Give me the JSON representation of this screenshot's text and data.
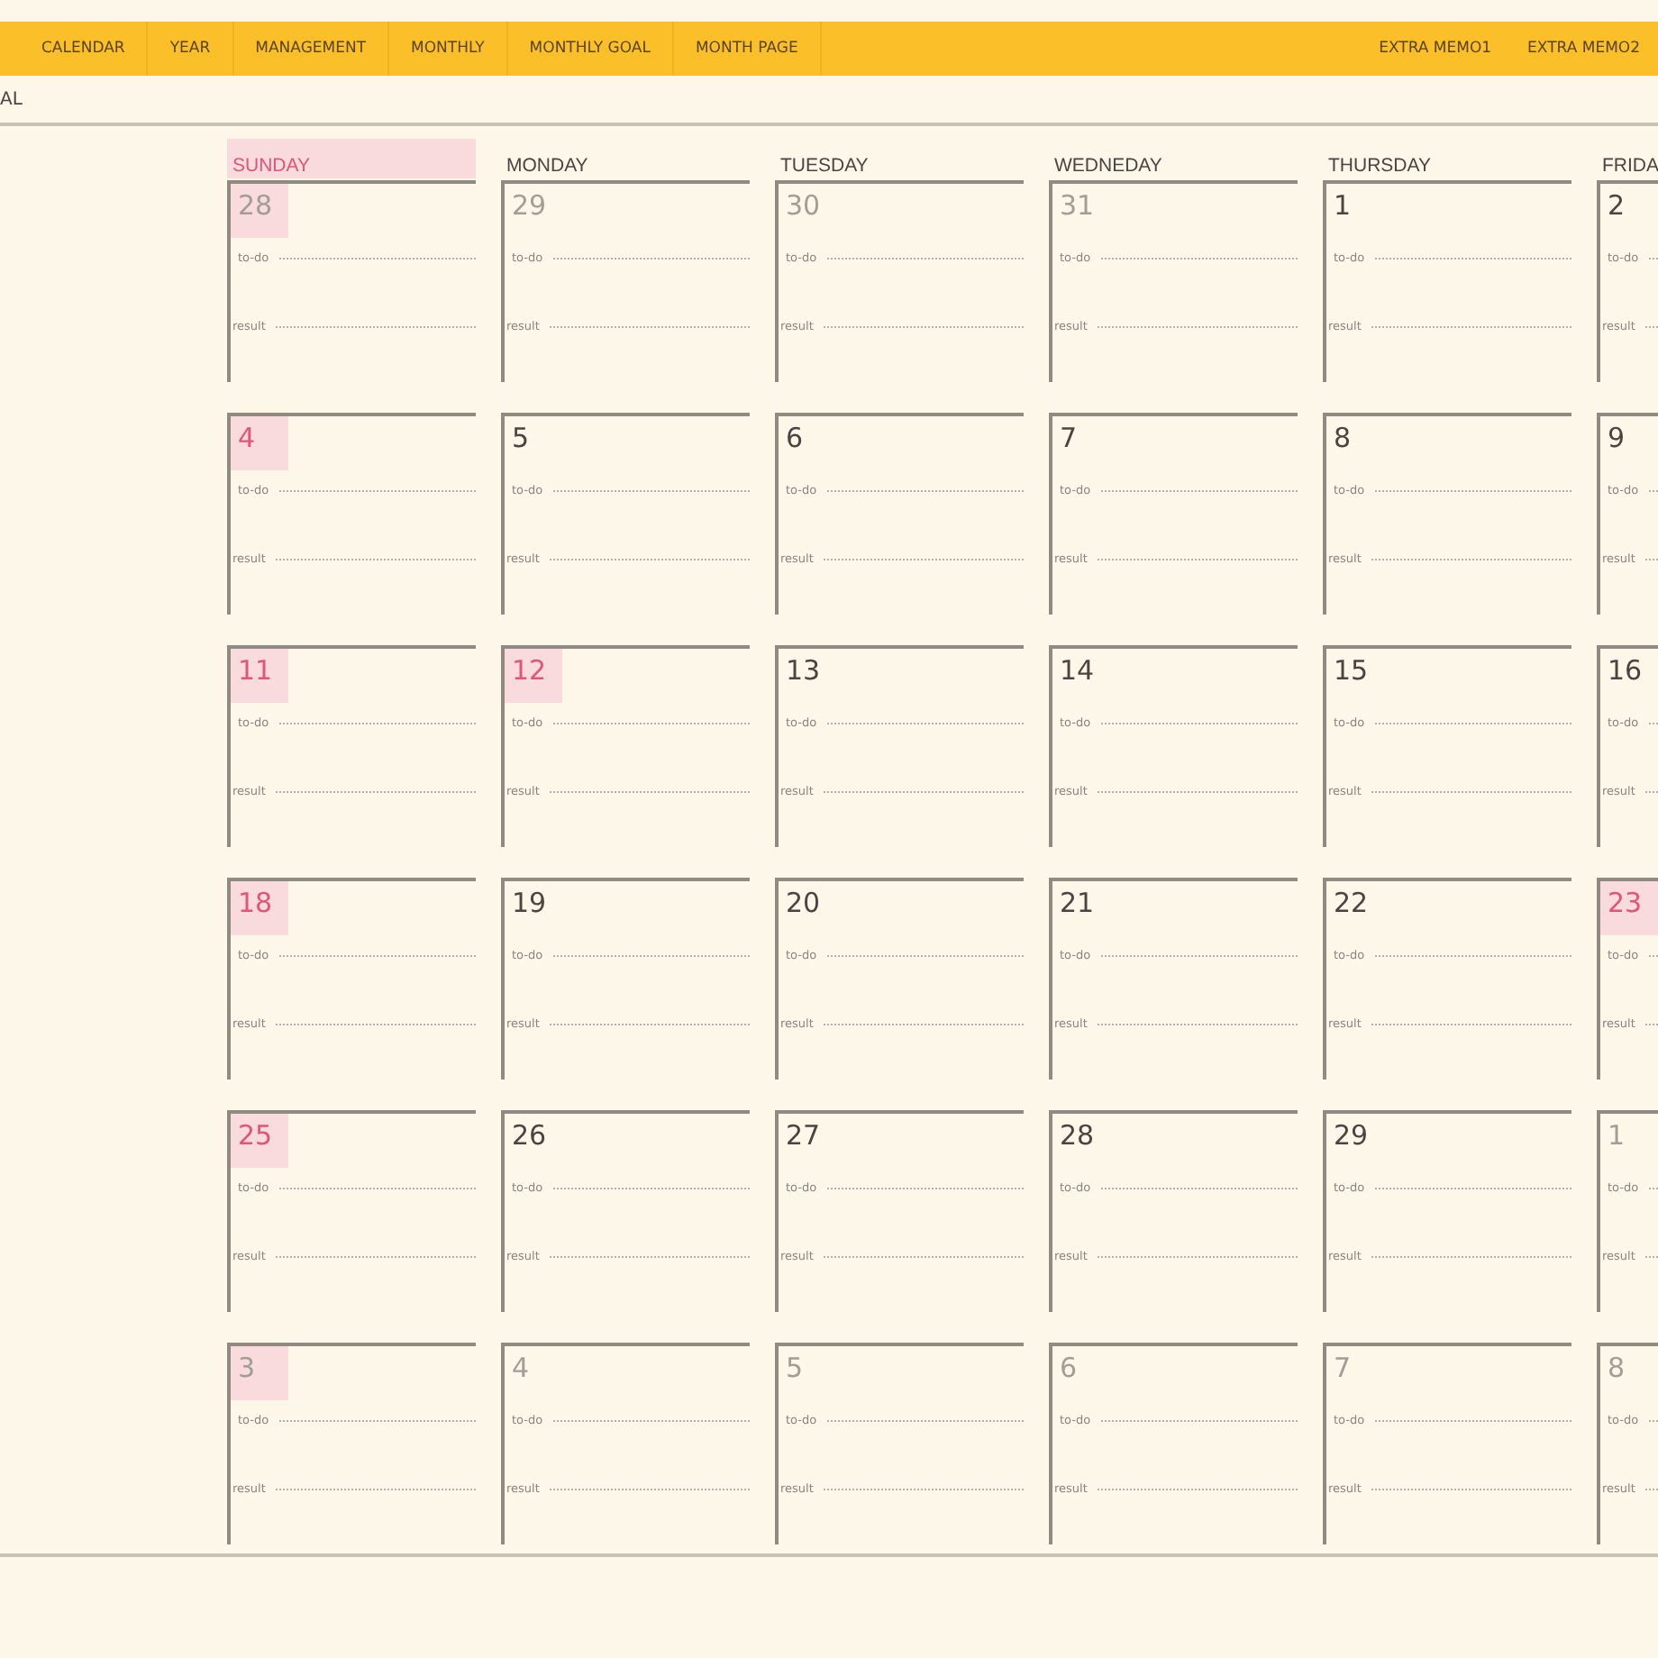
{
  "nav_tabs": [
    {
      "label": "CALENDAR"
    },
    {
      "label": "YEAR"
    },
    {
      "label": "MANAGEMENT"
    },
    {
      "label": "MONTHLY"
    },
    {
      "label": "MONTHLY GOAL"
    },
    {
      "label": "MONTH PAGE"
    }
  ],
  "nav_tabs_right": [
    {
      "label": "EXTRA MEMO1"
    },
    {
      "label": "EXTRA MEMO2"
    }
  ],
  "section_title": "AL",
  "weekdays": [
    {
      "label": "SUNDAY",
      "holiday": true
    },
    {
      "label": "MONDAY",
      "holiday": false
    },
    {
      "label": "TUESDAY",
      "holiday": false
    },
    {
      "label": "WEDNEDAY",
      "holiday": false
    },
    {
      "label": "THURSDAY",
      "holiday": false
    },
    {
      "label": "FRIDA",
      "holiday": false
    }
  ],
  "weeks": [
    [
      {
        "number": "28",
        "holiday": true,
        "other_month": true,
        "todo": "to-do",
        "result": "result"
      },
      {
        "number": "29",
        "holiday": false,
        "other_month": true,
        "todo": "to-do",
        "result": "result"
      },
      {
        "number": "30",
        "holiday": false,
        "other_month": true,
        "todo": "to-do",
        "result": "result"
      },
      {
        "number": "31",
        "holiday": false,
        "other_month": true,
        "todo": "to-do",
        "result": "result"
      },
      {
        "number": "1",
        "holiday": false,
        "other_month": false,
        "todo": "to-do",
        "result": "result"
      },
      {
        "number": "2",
        "holiday": false,
        "other_month": false,
        "todo": "to-do",
        "result": "result"
      }
    ],
    [
      {
        "number": "4",
        "holiday": true,
        "other_month": false,
        "todo": "to-do",
        "result": "result"
      },
      {
        "number": "5",
        "holiday": false,
        "other_month": false,
        "todo": "to-do",
        "result": "result"
      },
      {
        "number": "6",
        "holiday": false,
        "other_month": false,
        "todo": "to-do",
        "result": "result"
      },
      {
        "number": "7",
        "holiday": false,
        "other_month": false,
        "todo": "to-do",
        "result": "result"
      },
      {
        "number": "8",
        "holiday": false,
        "other_month": false,
        "todo": "to-do",
        "result": "result"
      },
      {
        "number": "9",
        "holiday": false,
        "other_month": false,
        "todo": "to-do",
        "result": "result"
      }
    ],
    [
      {
        "number": "11",
        "holiday": true,
        "other_month": false,
        "todo": "to-do",
        "result": "result"
      },
      {
        "number": "12",
        "holiday": true,
        "other_month": false,
        "todo": "to-do",
        "result": "result"
      },
      {
        "number": "13",
        "holiday": false,
        "other_month": false,
        "todo": "to-do",
        "result": "result"
      },
      {
        "number": "14",
        "holiday": false,
        "other_month": false,
        "todo": "to-do",
        "result": "result"
      },
      {
        "number": "15",
        "holiday": false,
        "other_month": false,
        "todo": "to-do",
        "result": "result"
      },
      {
        "number": "16",
        "holiday": false,
        "other_month": false,
        "todo": "to-do",
        "result": "result"
      }
    ],
    [
      {
        "number": "18",
        "holiday": true,
        "other_month": false,
        "todo": "to-do",
        "result": "result"
      },
      {
        "number": "19",
        "holiday": false,
        "other_month": false,
        "todo": "to-do",
        "result": "result"
      },
      {
        "number": "20",
        "holiday": false,
        "other_month": false,
        "todo": "to-do",
        "result": "result"
      },
      {
        "number": "21",
        "holiday": false,
        "other_month": false,
        "todo": "to-do",
        "result": "result"
      },
      {
        "number": "22",
        "holiday": false,
        "other_month": false,
        "todo": "to-do",
        "result": "result"
      },
      {
        "number": "23",
        "holiday": true,
        "other_month": false,
        "todo": "to-do",
        "result": "result"
      }
    ],
    [
      {
        "number": "25",
        "holiday": true,
        "other_month": false,
        "todo": "to-do",
        "result": "result"
      },
      {
        "number": "26",
        "holiday": false,
        "other_month": false,
        "todo": "to-do",
        "result": "result"
      },
      {
        "number": "27",
        "holiday": false,
        "other_month": false,
        "todo": "to-do",
        "result": "result"
      },
      {
        "number": "28",
        "holiday": false,
        "other_month": false,
        "todo": "to-do",
        "result": "result"
      },
      {
        "number": "29",
        "holiday": false,
        "other_month": false,
        "todo": "to-do",
        "result": "result"
      },
      {
        "number": "1",
        "holiday": false,
        "other_month": true,
        "todo": "to-do",
        "result": "result"
      }
    ],
    [
      {
        "number": "3",
        "holiday": true,
        "other_month": true,
        "todo": "to-do",
        "result": "result"
      },
      {
        "number": "4",
        "holiday": false,
        "other_month": true,
        "todo": "to-do",
        "result": "result"
      },
      {
        "number": "5",
        "holiday": false,
        "other_month": true,
        "todo": "to-do",
        "result": "result"
      },
      {
        "number": "6",
        "holiday": false,
        "other_month": true,
        "todo": "to-do",
        "result": "result"
      },
      {
        "number": "7",
        "holiday": false,
        "other_month": true,
        "todo": "to-do",
        "result": "result"
      },
      {
        "number": "8",
        "holiday": false,
        "other_month": true,
        "todo": "to-do",
        "result": "result"
      }
    ]
  ]
}
